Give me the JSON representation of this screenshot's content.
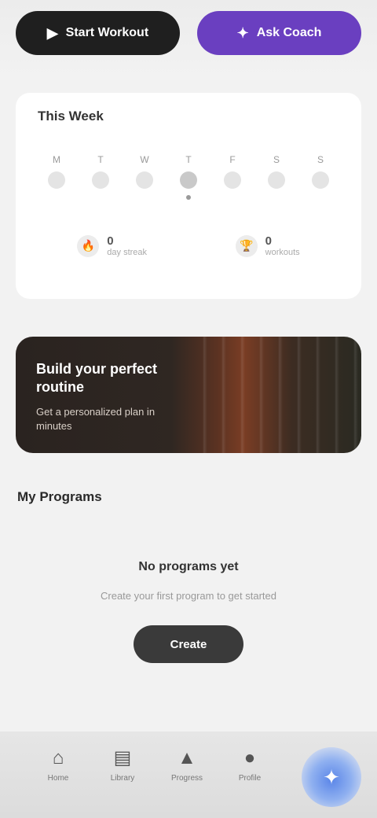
{
  "top_actions": {
    "primary_label": "Start Workout",
    "primary_icon": "play-icon",
    "secondary_label": "Ask Coach",
    "secondary_icon": "sparkle-icon",
    "secondary_color": "#6a3fc0"
  },
  "calendar": {
    "title": "This Week",
    "days": [
      {
        "letter": "M",
        "today": false
      },
      {
        "letter": "T",
        "today": false
      },
      {
        "letter": "W",
        "today": false
      },
      {
        "letter": "T",
        "today": true
      },
      {
        "letter": "F",
        "today": false
      },
      {
        "letter": "S",
        "today": false
      },
      {
        "letter": "S",
        "today": false
      }
    ],
    "stats": [
      {
        "icon": "flame-icon",
        "value": "0",
        "label": "day streak"
      },
      {
        "icon": "trophy-icon",
        "value": "0",
        "label": "workouts"
      }
    ]
  },
  "banner": {
    "title": "Build your perfect routine",
    "subtitle": "Get a personalized plan in minutes"
  },
  "programs": {
    "section_title": "My Programs",
    "empty_title": "No programs yet",
    "empty_subtitle": "Create your first program to get started",
    "empty_button": "Create"
  },
  "bottom_nav": {
    "items": [
      {
        "label": "Home",
        "icon": "home-icon"
      },
      {
        "label": "Library",
        "icon": "book-icon"
      },
      {
        "label": "Progress",
        "icon": "chart-icon"
      },
      {
        "label": "Profile",
        "icon": "user-icon"
      }
    ],
    "fab_icon": "coach-icon"
  }
}
